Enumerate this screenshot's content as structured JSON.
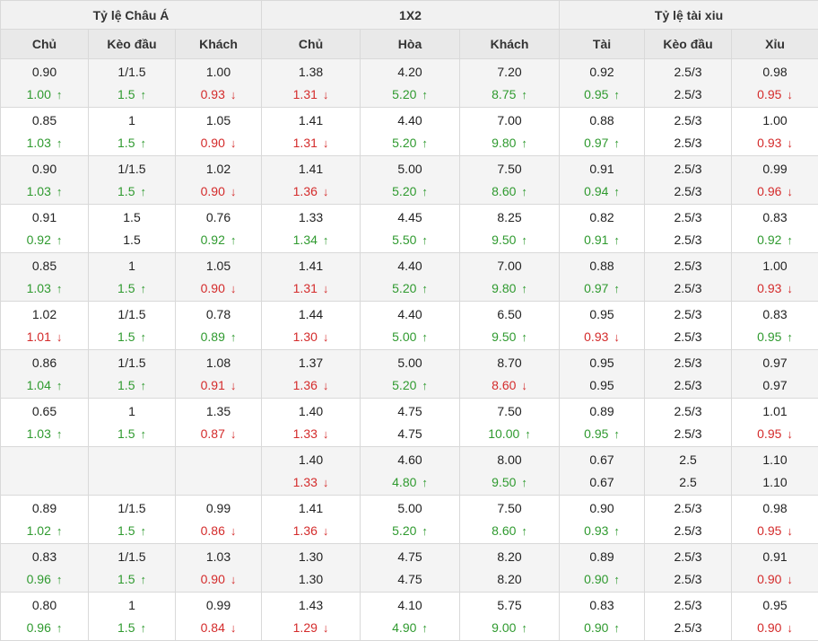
{
  "groups": [
    {
      "label": "Tỷ lệ Châu Á",
      "span": 3
    },
    {
      "label": "1X2",
      "span": 3
    },
    {
      "label": "Tỷ lệ tài xiu",
      "span": 3
    }
  ],
  "columns": [
    "Chủ",
    "Kèo đầu",
    "Khách",
    "Chủ",
    "Hòa",
    "Khách",
    "Tài",
    "Kèo đầu",
    "Xỉu"
  ],
  "colors": {
    "up": "#2f9a2f",
    "down": "#d42b2b",
    "header_bg": "#f1f1f1",
    "alt_row": "#f4f4f4"
  },
  "icons": {
    "up": "arrow-up-icon",
    "down": "arrow-down-icon"
  },
  "rows": [
    {
      "cells": [
        [
          "0.90",
          [
            "1.00",
            "up"
          ]
        ],
        [
          "1/1.5",
          [
            "1.5",
            "up"
          ]
        ],
        [
          "1.00",
          [
            "0.93",
            "down"
          ]
        ],
        [
          "1.38",
          [
            "1.31",
            "down"
          ]
        ],
        [
          "4.20",
          [
            "5.20",
            "up"
          ]
        ],
        [
          "7.20",
          [
            "8.75",
            "up"
          ]
        ],
        [
          "0.92",
          [
            "0.95",
            "up"
          ]
        ],
        [
          "2.5/3",
          [
            "2.5/3",
            "same"
          ]
        ],
        [
          "0.98",
          [
            "0.95",
            "down"
          ]
        ]
      ]
    },
    {
      "cells": [
        [
          "0.85",
          [
            "1.03",
            "up"
          ]
        ],
        [
          "1",
          [
            "1.5",
            "up"
          ]
        ],
        [
          "1.05",
          [
            "0.90",
            "down"
          ]
        ],
        [
          "1.41",
          [
            "1.31",
            "down"
          ]
        ],
        [
          "4.40",
          [
            "5.20",
            "up"
          ]
        ],
        [
          "7.00",
          [
            "9.80",
            "up"
          ]
        ],
        [
          "0.88",
          [
            "0.97",
            "up"
          ]
        ],
        [
          "2.5/3",
          [
            "2.5/3",
            "same"
          ]
        ],
        [
          "1.00",
          [
            "0.93",
            "down"
          ]
        ]
      ]
    },
    {
      "cells": [
        [
          "0.90",
          [
            "1.03",
            "up"
          ]
        ],
        [
          "1/1.5",
          [
            "1.5",
            "up"
          ]
        ],
        [
          "1.02",
          [
            "0.90",
            "down"
          ]
        ],
        [
          "1.41",
          [
            "1.36",
            "down"
          ]
        ],
        [
          "5.00",
          [
            "5.20",
            "up"
          ]
        ],
        [
          "7.50",
          [
            "8.60",
            "up"
          ]
        ],
        [
          "0.91",
          [
            "0.94",
            "up"
          ]
        ],
        [
          "2.5/3",
          [
            "2.5/3",
            "same"
          ]
        ],
        [
          "0.99",
          [
            "0.96",
            "down"
          ]
        ]
      ]
    },
    {
      "cells": [
        [
          "0.91",
          [
            "0.92",
            "up"
          ]
        ],
        [
          "1.5",
          [
            "1.5",
            "same"
          ]
        ],
        [
          "0.76",
          [
            "0.92",
            "up"
          ]
        ],
        [
          "1.33",
          [
            "1.34",
            "up"
          ]
        ],
        [
          "4.45",
          [
            "5.50",
            "up"
          ]
        ],
        [
          "8.25",
          [
            "9.50",
            "up"
          ]
        ],
        [
          "0.82",
          [
            "0.91",
            "up"
          ]
        ],
        [
          "2.5/3",
          [
            "2.5/3",
            "same"
          ]
        ],
        [
          "0.83",
          [
            "0.92",
            "up"
          ]
        ]
      ]
    },
    {
      "cells": [
        [
          "0.85",
          [
            "1.03",
            "up"
          ]
        ],
        [
          "1",
          [
            "1.5",
            "up"
          ]
        ],
        [
          "1.05",
          [
            "0.90",
            "down"
          ]
        ],
        [
          "1.41",
          [
            "1.31",
            "down"
          ]
        ],
        [
          "4.40",
          [
            "5.20",
            "up"
          ]
        ],
        [
          "7.00",
          [
            "9.80",
            "up"
          ]
        ],
        [
          "0.88",
          [
            "0.97",
            "up"
          ]
        ],
        [
          "2.5/3",
          [
            "2.5/3",
            "same"
          ]
        ],
        [
          "1.00",
          [
            "0.93",
            "down"
          ]
        ]
      ]
    },
    {
      "cells": [
        [
          "1.02",
          [
            "1.01",
            "down"
          ]
        ],
        [
          "1/1.5",
          [
            "1.5",
            "up"
          ]
        ],
        [
          "0.78",
          [
            "0.89",
            "up"
          ]
        ],
        [
          "1.44",
          [
            "1.30",
            "down"
          ]
        ],
        [
          "4.40",
          [
            "5.00",
            "up"
          ]
        ],
        [
          "6.50",
          [
            "9.50",
            "up"
          ]
        ],
        [
          "0.95",
          [
            "0.93",
            "down"
          ]
        ],
        [
          "2.5/3",
          [
            "2.5/3",
            "same"
          ]
        ],
        [
          "0.83",
          [
            "0.95",
            "up"
          ]
        ]
      ]
    },
    {
      "cells": [
        [
          "0.86",
          [
            "1.04",
            "up"
          ]
        ],
        [
          "1/1.5",
          [
            "1.5",
            "up"
          ]
        ],
        [
          "1.08",
          [
            "0.91",
            "down"
          ]
        ],
        [
          "1.37",
          [
            "1.36",
            "down"
          ]
        ],
        [
          "5.00",
          [
            "5.20",
            "up"
          ]
        ],
        [
          "8.70",
          [
            "8.60",
            "down"
          ]
        ],
        [
          "0.95",
          [
            "0.95",
            "same"
          ]
        ],
        [
          "2.5/3",
          [
            "2.5/3",
            "same"
          ]
        ],
        [
          "0.97",
          [
            "0.97",
            "same"
          ]
        ]
      ]
    },
    {
      "cells": [
        [
          "0.65",
          [
            "1.03",
            "up"
          ]
        ],
        [
          "1",
          [
            "1.5",
            "up"
          ]
        ],
        [
          "1.35",
          [
            "0.87",
            "down"
          ]
        ],
        [
          "1.40",
          [
            "1.33",
            "down"
          ]
        ],
        [
          "4.75",
          [
            "4.75",
            "same"
          ]
        ],
        [
          "7.50",
          [
            "10.00",
            "up"
          ]
        ],
        [
          "0.89",
          [
            "0.95",
            "up"
          ]
        ],
        [
          "2.5/3",
          [
            "2.5/3",
            "same"
          ]
        ],
        [
          "1.01",
          [
            "0.95",
            "down"
          ]
        ]
      ]
    },
    {
      "cells": [
        [
          "",
          [
            "",
            "same"
          ]
        ],
        [
          "",
          [
            "",
            "same"
          ]
        ],
        [
          "",
          [
            "",
            "same"
          ]
        ],
        [
          "1.40",
          [
            "1.33",
            "down"
          ]
        ],
        [
          "4.60",
          [
            "4.80",
            "up"
          ]
        ],
        [
          "8.00",
          [
            "9.50",
            "up"
          ]
        ],
        [
          "0.67",
          [
            "0.67",
            "same"
          ]
        ],
        [
          "2.5",
          [
            "2.5",
            "same"
          ]
        ],
        [
          "1.10",
          [
            "1.10",
            "same"
          ]
        ]
      ]
    },
    {
      "cells": [
        [
          "0.89",
          [
            "1.02",
            "up"
          ]
        ],
        [
          "1/1.5",
          [
            "1.5",
            "up"
          ]
        ],
        [
          "0.99",
          [
            "0.86",
            "down"
          ]
        ],
        [
          "1.41",
          [
            "1.36",
            "down"
          ]
        ],
        [
          "5.00",
          [
            "5.20",
            "up"
          ]
        ],
        [
          "7.50",
          [
            "8.60",
            "up"
          ]
        ],
        [
          "0.90",
          [
            "0.93",
            "up"
          ]
        ],
        [
          "2.5/3",
          [
            "2.5/3",
            "same"
          ]
        ],
        [
          "0.98",
          [
            "0.95",
            "down"
          ]
        ]
      ]
    },
    {
      "cells": [
        [
          "0.83",
          [
            "0.96",
            "up"
          ]
        ],
        [
          "1/1.5",
          [
            "1.5",
            "up"
          ]
        ],
        [
          "1.03",
          [
            "0.90",
            "down"
          ]
        ],
        [
          "1.30",
          [
            "1.30",
            "same"
          ]
        ],
        [
          "4.75",
          [
            "4.75",
            "same"
          ]
        ],
        [
          "8.20",
          [
            "8.20",
            "same"
          ]
        ],
        [
          "0.89",
          [
            "0.90",
            "up"
          ]
        ],
        [
          "2.5/3",
          [
            "2.5/3",
            "same"
          ]
        ],
        [
          "0.91",
          [
            "0.90",
            "down"
          ]
        ]
      ]
    },
    {
      "cells": [
        [
          "0.80",
          [
            "0.96",
            "up"
          ]
        ],
        [
          "1",
          [
            "1.5",
            "up"
          ]
        ],
        [
          "0.99",
          [
            "0.84",
            "down"
          ]
        ],
        [
          "1.43",
          [
            "1.29",
            "down"
          ]
        ],
        [
          "4.10",
          [
            "4.90",
            "up"
          ]
        ],
        [
          "5.75",
          [
            "9.00",
            "up"
          ]
        ],
        [
          "0.83",
          [
            "0.90",
            "up"
          ]
        ],
        [
          "2.5/3",
          [
            "2.5/3",
            "same"
          ]
        ],
        [
          "0.95",
          [
            "0.90",
            "down"
          ]
        ]
      ]
    }
  ]
}
